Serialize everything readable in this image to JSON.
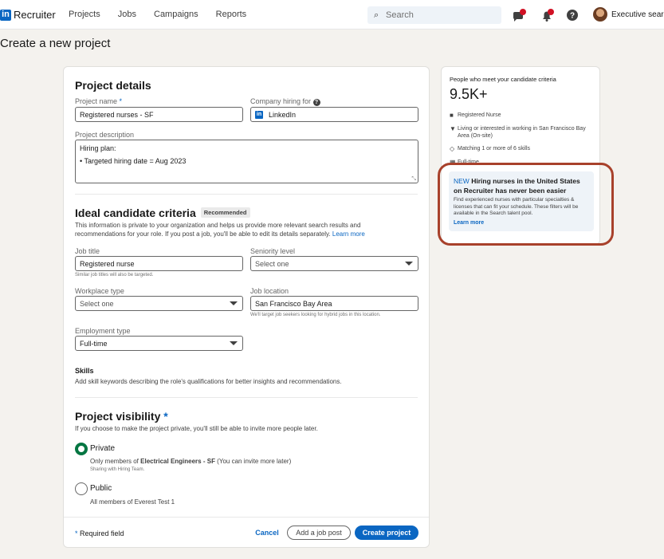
{
  "nav": {
    "logo_icon": "in",
    "logo_text": "Recruiter",
    "links": [
      "Projects",
      "Jobs",
      "Campaigns",
      "Reports"
    ],
    "search_placeholder": "Search",
    "user_name": "Executive search"
  },
  "page_title": "Create a new project",
  "project_details": {
    "heading": "Project details",
    "name_label": "Project name",
    "name_required_mark": "*",
    "name_value": "Registered nurses - SF",
    "company_label": "Company hiring for",
    "company_value": "LinkedIn",
    "description_label": "Project description",
    "description_line1": "Hiring plan:",
    "description_line2": "• Targeted hiring date = Aug 2023"
  },
  "criteria": {
    "heading": "Ideal candidate criteria",
    "badge": "Recommended",
    "intro_line1": "This information is private to your organization and helps us provide more relevant search results and",
    "intro_line2": "recommendations for your role. If you post a job, you'll be able to edit its details separately.",
    "learn_more": "Learn more",
    "job_title_label": "Job title",
    "job_title_value": "Registered nurse",
    "job_title_hint": "Similar job titles will also be targeted.",
    "seniority_label": "Seniority level",
    "seniority_value": "Select one",
    "workplace_label": "Workplace type",
    "workplace_value": "Select one",
    "location_label": "Job location",
    "location_value": "San Francisco Bay Area",
    "location_hint": "We'll target job seekers looking for hybrid jobs in this location.",
    "employment_label": "Employment type",
    "employment_value": "Full-time",
    "skills_heading": "Skills",
    "skills_text": "Add skill keywords describing the role's qualifications for better insights and recommendations."
  },
  "visibility": {
    "heading": "Project visibility",
    "required_mark": "*",
    "text": "If you choose to make the project private, you'll still be able to invite more people later.",
    "private_label": "Private",
    "private_desc_prefix": "Only members of ",
    "private_desc_bold": "Electrical Engineers - SF",
    "private_desc_suffix": " (You can invite more later)",
    "private_sub": "Sharing with Hiring Team.",
    "public_label": "Public",
    "public_desc": "All members of Everest Test 1"
  },
  "footer": {
    "required_note_mark": "*",
    "required_note": "Required field",
    "cancel": "Cancel",
    "add_job_post": "Add a job post",
    "create_project": "Create project"
  },
  "side_panel": {
    "title": "People who meet your candidate criteria",
    "count": "9.5K+",
    "items": [
      {
        "icon": "briefcase-icon",
        "text": "Registered Nurse"
      },
      {
        "icon": "location-pin-icon",
        "text": "Living or interested in working in San Francisco Bay Area (On-site)"
      },
      {
        "icon": "diamond-icon",
        "text": "Matching 1 or more of 6 skills"
      },
      {
        "icon": "calendar-icon",
        "text": "Full-time"
      }
    ],
    "promo_new": "NEW",
    "promo_title": "Hiring nurses in the United States on Recruiter has never been easier",
    "promo_text": "Find experienced nurses with particular specialties & licenses that can fit your schedule. These filters will be available in the Search talent pool.",
    "promo_link": "Learn more"
  },
  "colors": {
    "accent": "#0a66c2",
    "success": "#057642",
    "highlight_ring": "#a8412b"
  }
}
